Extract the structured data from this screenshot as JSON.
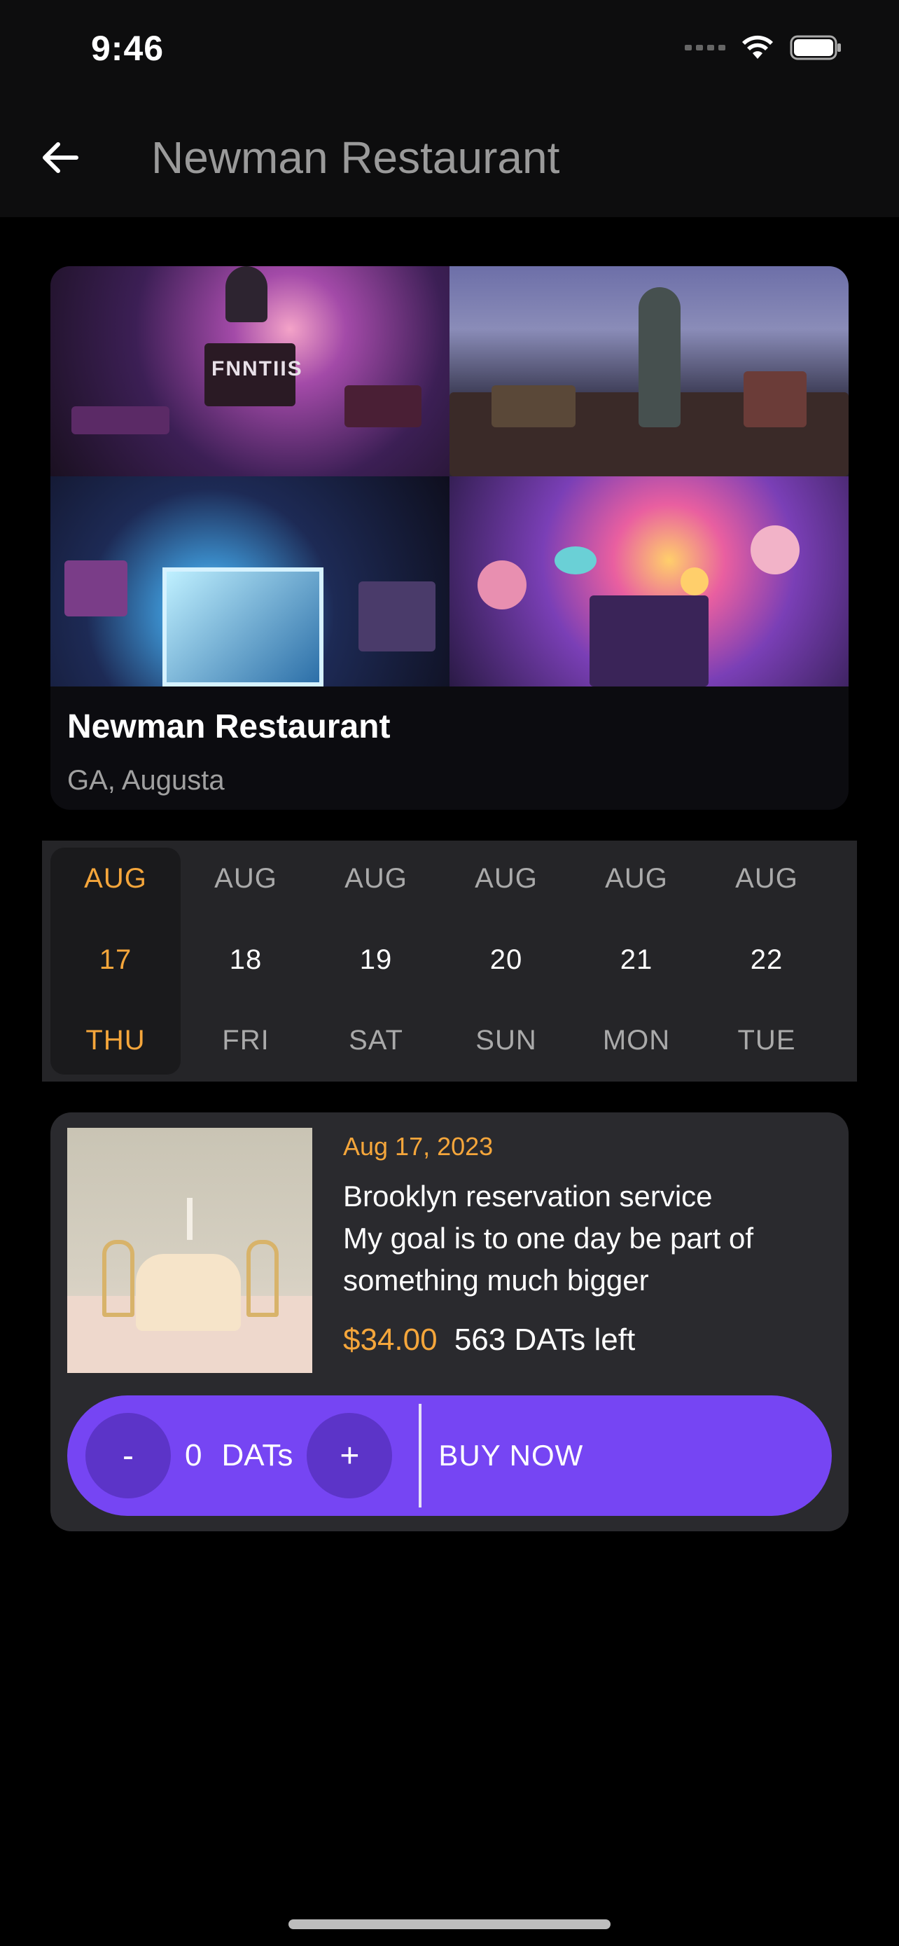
{
  "status_bar": {
    "time": "9:46"
  },
  "header": {
    "title": "Newman Restaurant"
  },
  "restaurant": {
    "name": "Newman Restaurant",
    "location": "GA, Augusta",
    "collage_sign": "FNNTIIS"
  },
  "dates": [
    {
      "month": "AUG",
      "day": "17",
      "weekday": "THU",
      "selected": true
    },
    {
      "month": "AUG",
      "day": "18",
      "weekday": "FRI",
      "selected": false
    },
    {
      "month": "AUG",
      "day": "19",
      "weekday": "SAT",
      "selected": false
    },
    {
      "month": "AUG",
      "day": "20",
      "weekday": "SUN",
      "selected": false
    },
    {
      "month": "AUG",
      "day": "21",
      "weekday": "MON",
      "selected": false
    },
    {
      "month": "AUG",
      "day": "22",
      "weekday": "TUE",
      "selected": false
    }
  ],
  "offer": {
    "date": "Aug 17, 2023",
    "title": "Brooklyn reservation service",
    "description": "My goal is to one day be part of something much bigger",
    "price": "$34.00",
    "remaining": "563 DATs left"
  },
  "purchase": {
    "minus_label": "-",
    "plus_label": "+",
    "quantity": "0",
    "unit": "DATs",
    "buy_label": "BUY NOW"
  },
  "colors": {
    "accent": "#f5a63b",
    "primary": "#7645f3",
    "card": "#2a2a2e",
    "background": "#000000"
  }
}
